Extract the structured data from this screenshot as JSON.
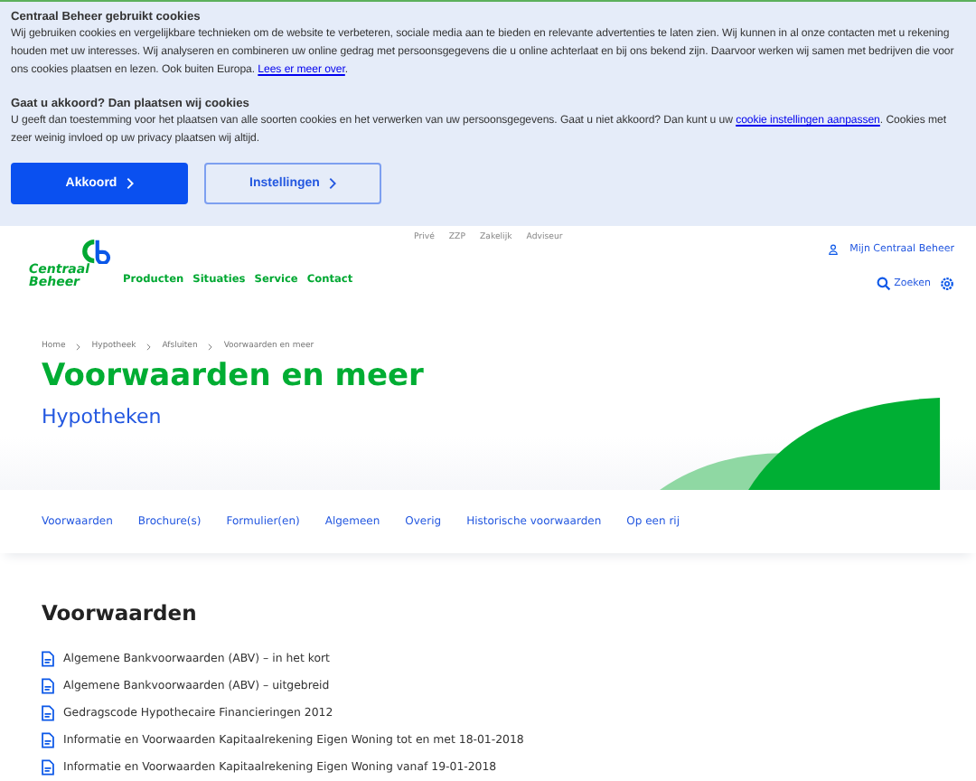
{
  "cookie_banner": {
    "title": "Centraal Beheer gebruikt cookies",
    "paragraph_1": "Wij gebruiken cookies en vergelijkbare technieken om de website te verbeteren, sociale media aan te bieden en relevante advertenties te laten zien. Wij kunnen in al onze contacten met u rekening houden met uw interesses. Wij analyseren en combineren uw online gedrag met persoonsgegevens die u online achterlaat en bij ons bekend zijn. Daarvoor werken wij samen met bedrijven die voor ons cookies plaatsen en lezen. Ook buiten Europa.",
    "paragraph_1_link": "Lees er meer over",
    "paragraph_1_end": ".",
    "subtitle": "Gaat u akkoord? Dan plaatsen wij cookies",
    "paragraph_2": "U geeft dan toestemming voor het plaatsen van alle soorten cookies en het verwerken van uw persoonsgegevens. Gaat u niet akkoord? Dan kunt u uw",
    "paragraph_2_link": "cookie instellingen aanpassen",
    "paragraph_2_end": ". Cookies met zeer weinig invloed op uw privacy plaatsen wij altijd.",
    "buttons": [
      {
        "label": "Akkoord",
        "kind": "primary"
      },
      {
        "label": "Instellingen",
        "kind": "secondary"
      }
    ]
  },
  "header": {
    "logo": "Centraal Beheer",
    "top_links": [
      "Privé",
      "ZZP",
      "Zakelijk",
      "Adviseur"
    ],
    "account_link": "Mijn Centraal Beheer",
    "nav": [
      "Producten",
      "Situaties",
      "Service",
      "Contact"
    ],
    "search": "Zoeken"
  },
  "breadcrumb": [
    "Home",
    "Hypotheek",
    "Afsluiten",
    "Voorwaarden en meer"
  ],
  "page_title": "Voorwaarden en meer",
  "subtitle": "Hypotheken",
  "tabs": [
    "Voorwaarden",
    "Brochure(s)",
    "Formulier(en)",
    "Algemeen",
    "Overig",
    "Historische voorwaarden",
    "Op een rij"
  ],
  "section": {
    "title": "Voorwaarden",
    "documents": [
      "Algemene Bankvoorwaarden (ABV) – in het kort",
      "Algemene Bankvoorwaarden (ABV) – uitgebreid",
      "Gedragscode Hypothecaire Financieringen 2012",
      "Informatie en Voorwaarden Kapitaalrekening Eigen Woning tot en met 18-01-2018",
      "Informatie en Voorwaarden Kapitaalrekening Eigen Woning vanaf 19-01-2018"
    ]
  }
}
